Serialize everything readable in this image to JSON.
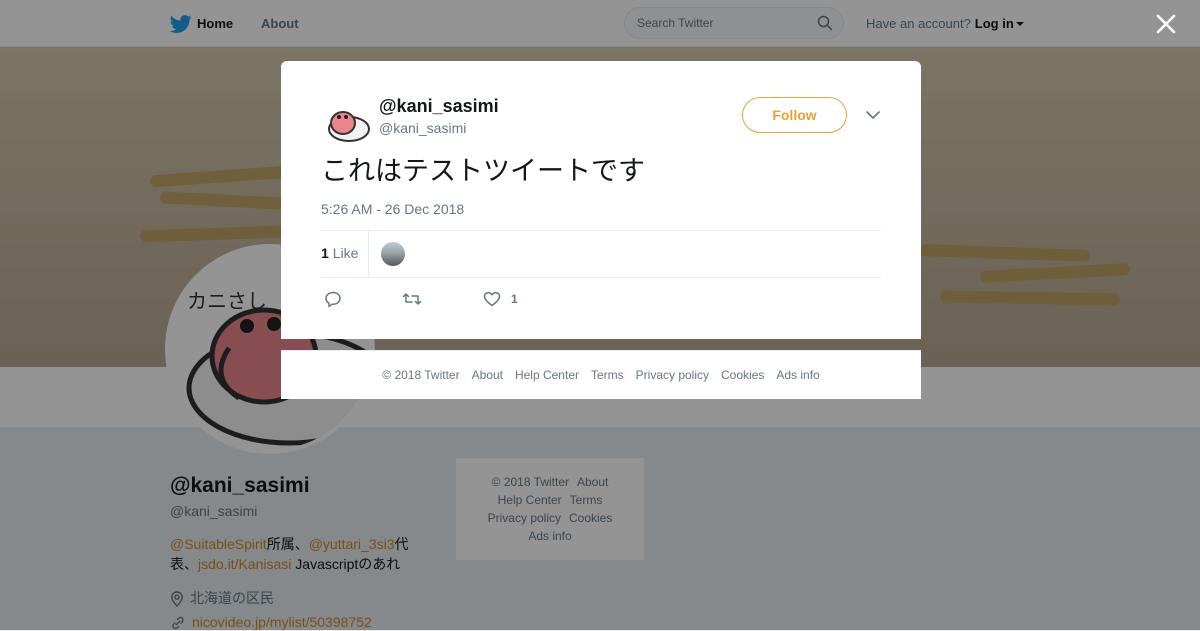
{
  "topbar": {
    "home_label": "Home",
    "about_label": "About",
    "search_placeholder": "Search Twitter",
    "account_prompt": "Have an account?",
    "login_label": "Log in"
  },
  "profile": {
    "name": "@kani_sasimi",
    "handle": "@kani_sasimi",
    "avatar_caption": "カニさし",
    "bio": {
      "link1": "@SuitableSpirit",
      "text1": "所属、",
      "link2": "@yuttari_3si3",
      "text2": "代表、",
      "link3": "jsdo.it/Kanisasi",
      "text3": " Javascriptのあれ"
    },
    "location": "北海道の区民",
    "url": "nicovideo.jp/mylist/50398752"
  },
  "sidebar_footer": {
    "copyright": "© 2018 Twitter",
    "about": "About",
    "help": "Help Center",
    "terms": "Terms",
    "privacy": "Privacy policy",
    "cookies": "Cookies",
    "ads": "Ads info"
  },
  "tweet": {
    "name": "@kani_sasimi",
    "handle": "@kani_sasimi",
    "follow_label": "Follow",
    "text": "これはテストツイートです",
    "timestamp": "5:26 AM - 26 Dec 2018",
    "likes_number": "1",
    "likes_label": "Like",
    "like_action_count": "1"
  },
  "modal_footer": {
    "copyright": "© 2018 Twitter",
    "about": "About",
    "help": "Help Center",
    "terms": "Terms",
    "privacy": "Privacy policy",
    "cookies": "Cookies",
    "ads": "Ads info"
  },
  "colors": {
    "accent": "#e8a432",
    "link": "#d08a1d",
    "brand": "#1da1f2",
    "overlay": "rgba(0,0,0,0.42)"
  },
  "icons": {
    "logo": "twitter-bird-icon",
    "search": "search-icon",
    "close": "close-icon",
    "more": "chevron-down-icon",
    "reply": "reply-icon",
    "retweet": "retweet-icon",
    "like": "heart-icon",
    "location": "location-pin-icon",
    "url": "link-icon"
  }
}
